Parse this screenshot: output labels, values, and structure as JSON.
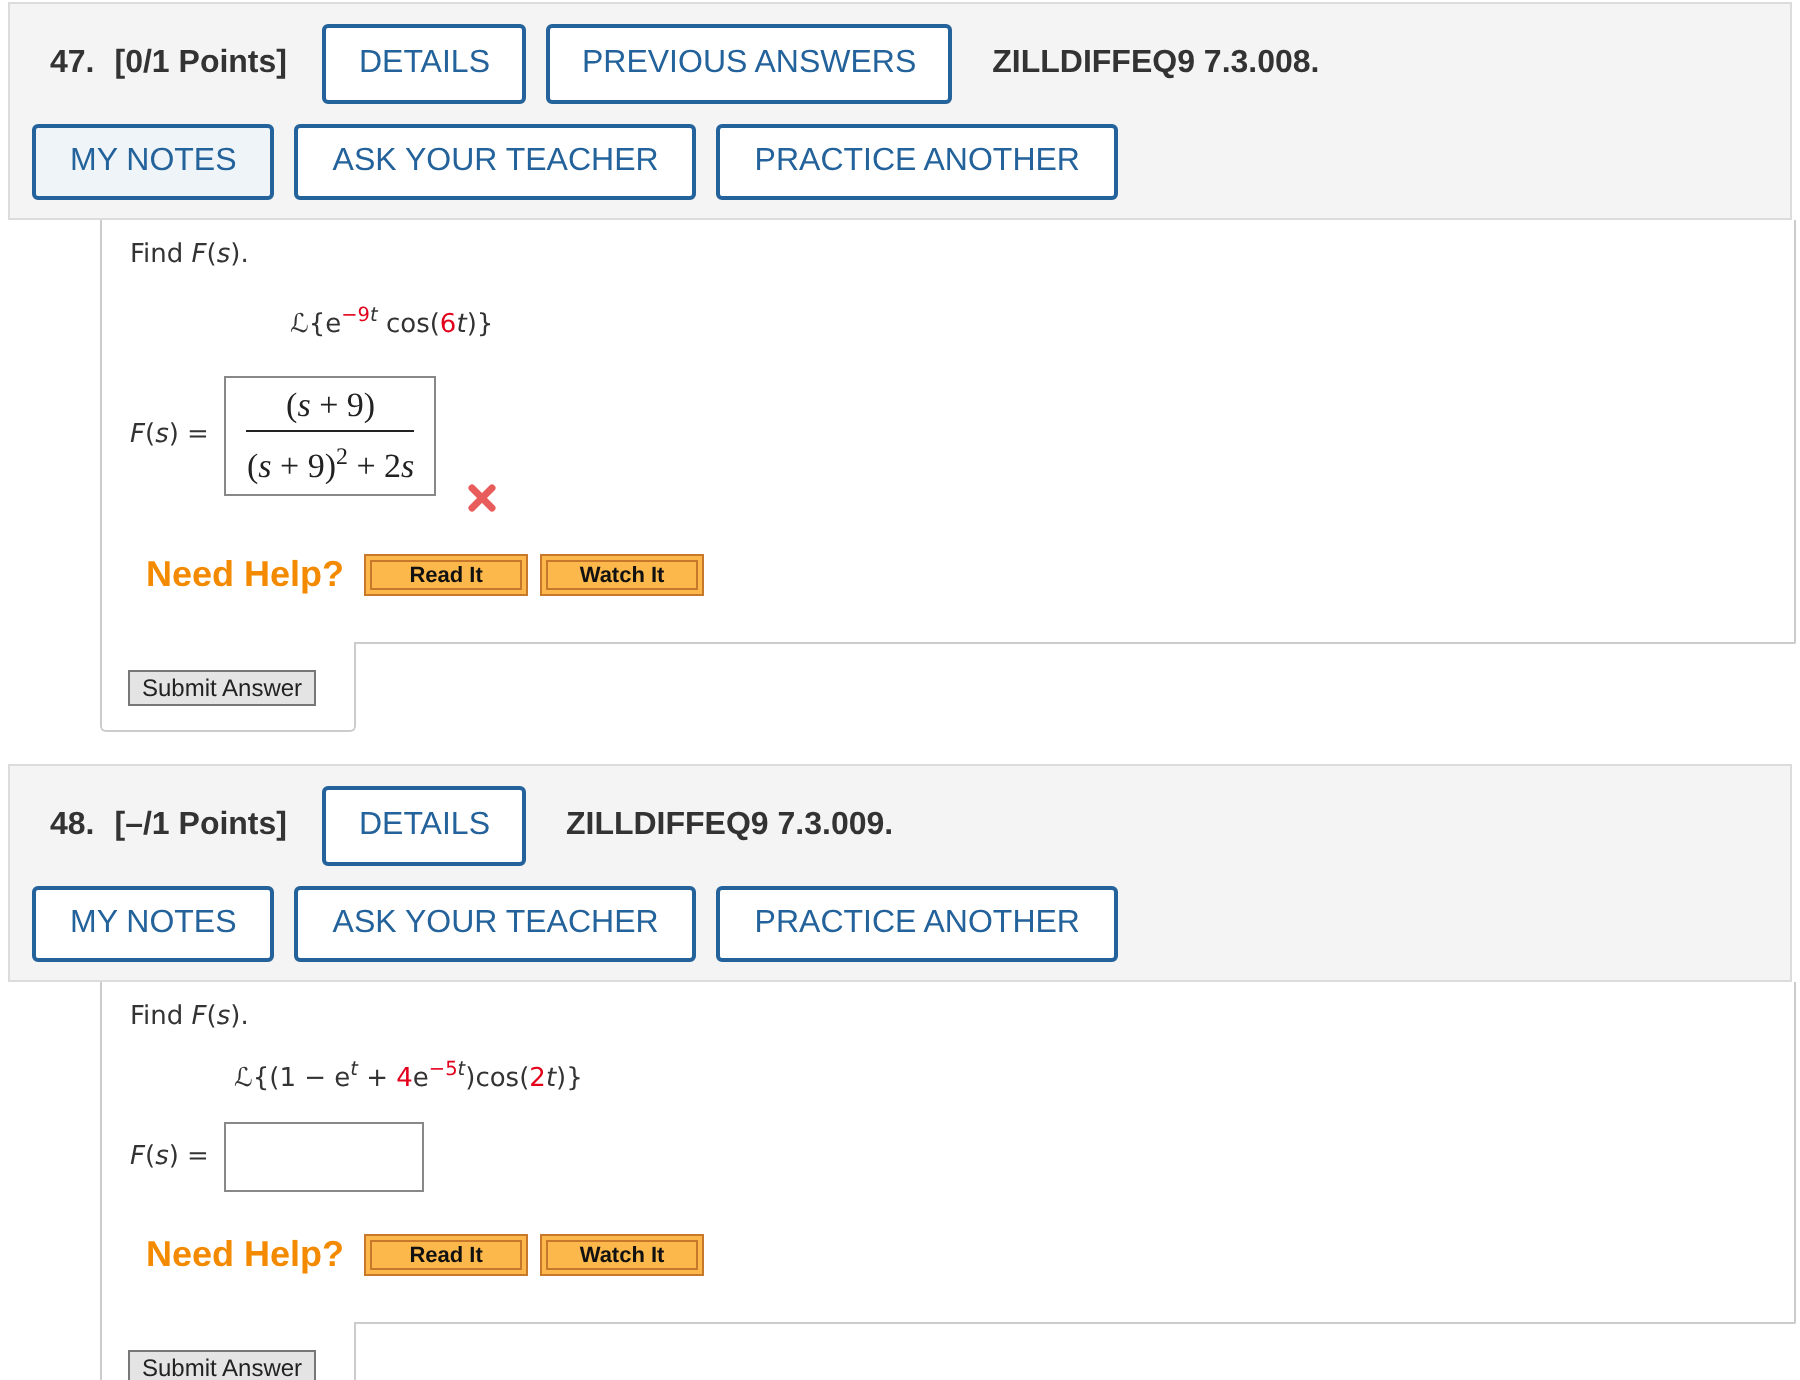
{
  "questions": [
    {
      "number": "47.",
      "points": "[0/1 Points]",
      "header_buttons": [
        "DETAILS",
        "PREVIOUS ANSWERS"
      ],
      "code": "ZILLDIFFEQ9 7.3.008.",
      "action_buttons": [
        {
          "label": "MY NOTES",
          "selected": true
        },
        {
          "label": "ASK YOUR TEACHER",
          "selected": false
        },
        {
          "label": "PRACTICE ANOTHER",
          "selected": false
        }
      ],
      "prompt": "Find *F*(*s*).",
      "expression": [
        {
          "kind": "plain",
          "text": "ℒ{e"
        },
        {
          "kind": "param_sup",
          "text": "−9"
        },
        {
          "kind": "italic_sup",
          "text": "t"
        },
        {
          "kind": "plain",
          "text": " cos("
        },
        {
          "kind": "param",
          "text": "6"
        },
        {
          "kind": "italic",
          "text": "t"
        },
        {
          "kind": "plain",
          "text": ")}"
        }
      ],
      "answer_label": "*F*(*s*) =",
      "answer": {
        "kind": "fraction",
        "numerator": [
          {
            "kind": "plain",
            "text": "("
          },
          {
            "kind": "italic",
            "text": "s"
          },
          {
            "kind": "plain",
            "text": " + 9)"
          }
        ],
        "denominator": [
          {
            "kind": "plain",
            "text": "("
          },
          {
            "kind": "italic",
            "text": "s"
          },
          {
            "kind": "plain",
            "text": " + 9)"
          },
          {
            "kind": "sup",
            "text": "2"
          },
          {
            "kind": "plain",
            "text": " + 2"
          },
          {
            "kind": "italic",
            "text": "s"
          }
        ]
      },
      "correct": false,
      "help_label": "Need Help?",
      "help_buttons": [
        "Read It",
        "Watch It"
      ],
      "submit": "Submit Answer"
    },
    {
      "number": "48.",
      "points": "[–/1 Points]",
      "header_buttons": [
        "DETAILS"
      ],
      "code": "ZILLDIFFEQ9 7.3.009.",
      "action_buttons": [
        {
          "label": "MY NOTES",
          "selected": false
        },
        {
          "label": "ASK YOUR TEACHER",
          "selected": false
        },
        {
          "label": "PRACTICE ANOTHER",
          "selected": false
        }
      ],
      "prompt": "Find *F*(*s*).",
      "expression": [
        {
          "kind": "plain",
          "text": "ℒ{(1 − e"
        },
        {
          "kind": "italic_sup",
          "text": "t"
        },
        {
          "kind": "plain",
          "text": " + "
        },
        {
          "kind": "param",
          "text": "4"
        },
        {
          "kind": "plain",
          "text": "e"
        },
        {
          "kind": "param_sup",
          "text": "−5"
        },
        {
          "kind": "italic_sup",
          "text": "t"
        },
        {
          "kind": "plain",
          "text": ")cos("
        },
        {
          "kind": "param",
          "text": "2"
        },
        {
          "kind": "italic",
          "text": "t"
        },
        {
          "kind": "plain",
          "text": ")}"
        }
      ],
      "answer_label": "*F*(*s*) =",
      "answer": {
        "kind": "blank"
      },
      "help_label": "Need Help?",
      "help_buttons": [
        "Read It",
        "Watch It"
      ],
      "submit": "Submit Answer"
    }
  ]
}
